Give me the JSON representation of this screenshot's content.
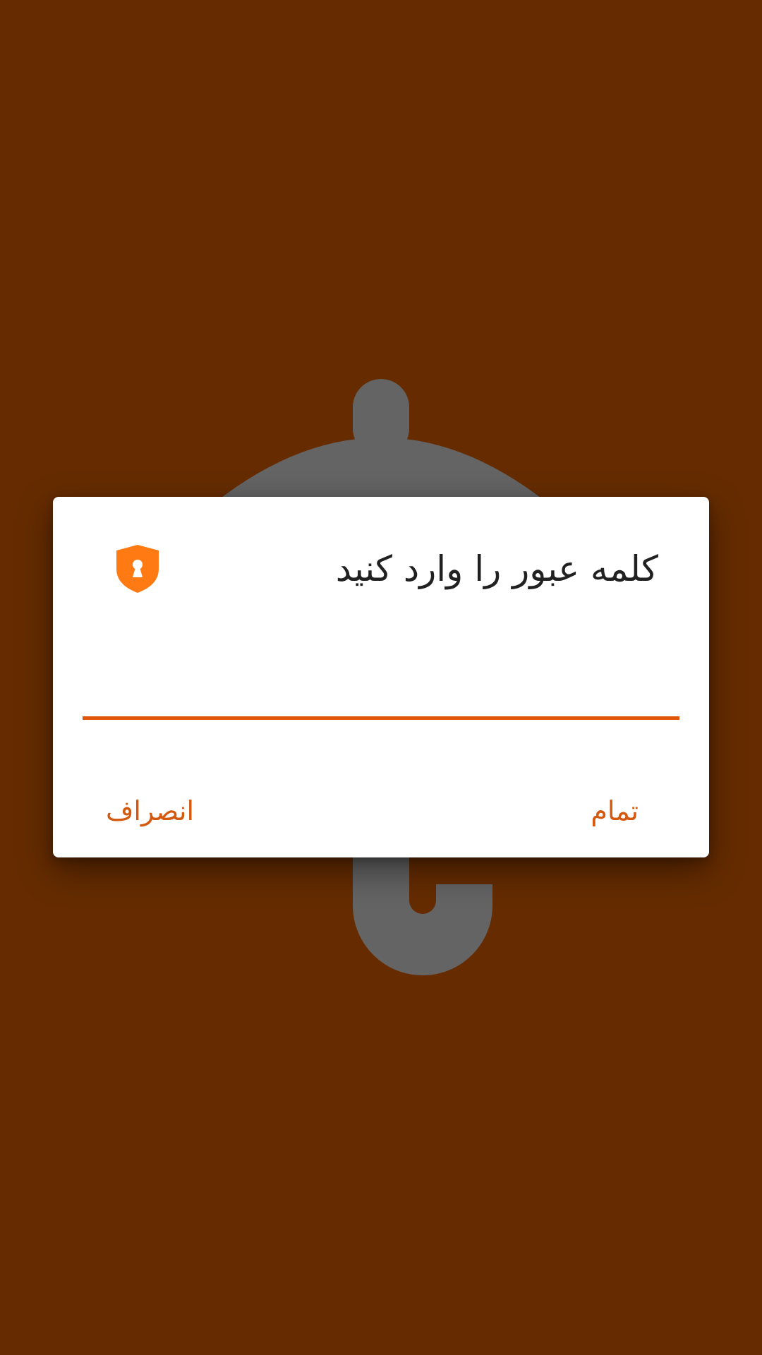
{
  "dialog": {
    "title": "کلمه عبور را وارد کنید",
    "password_value": "",
    "done_label": "تمام",
    "cancel_label": "انصراف"
  },
  "icons": {
    "dialog_icon": "shield-keyhole-icon",
    "background_icon": "umbrella-icon"
  },
  "colors": {
    "background": "#662c00",
    "accent": "#e0570a",
    "shield": "#ff7a12",
    "umbrella": "#646464"
  }
}
